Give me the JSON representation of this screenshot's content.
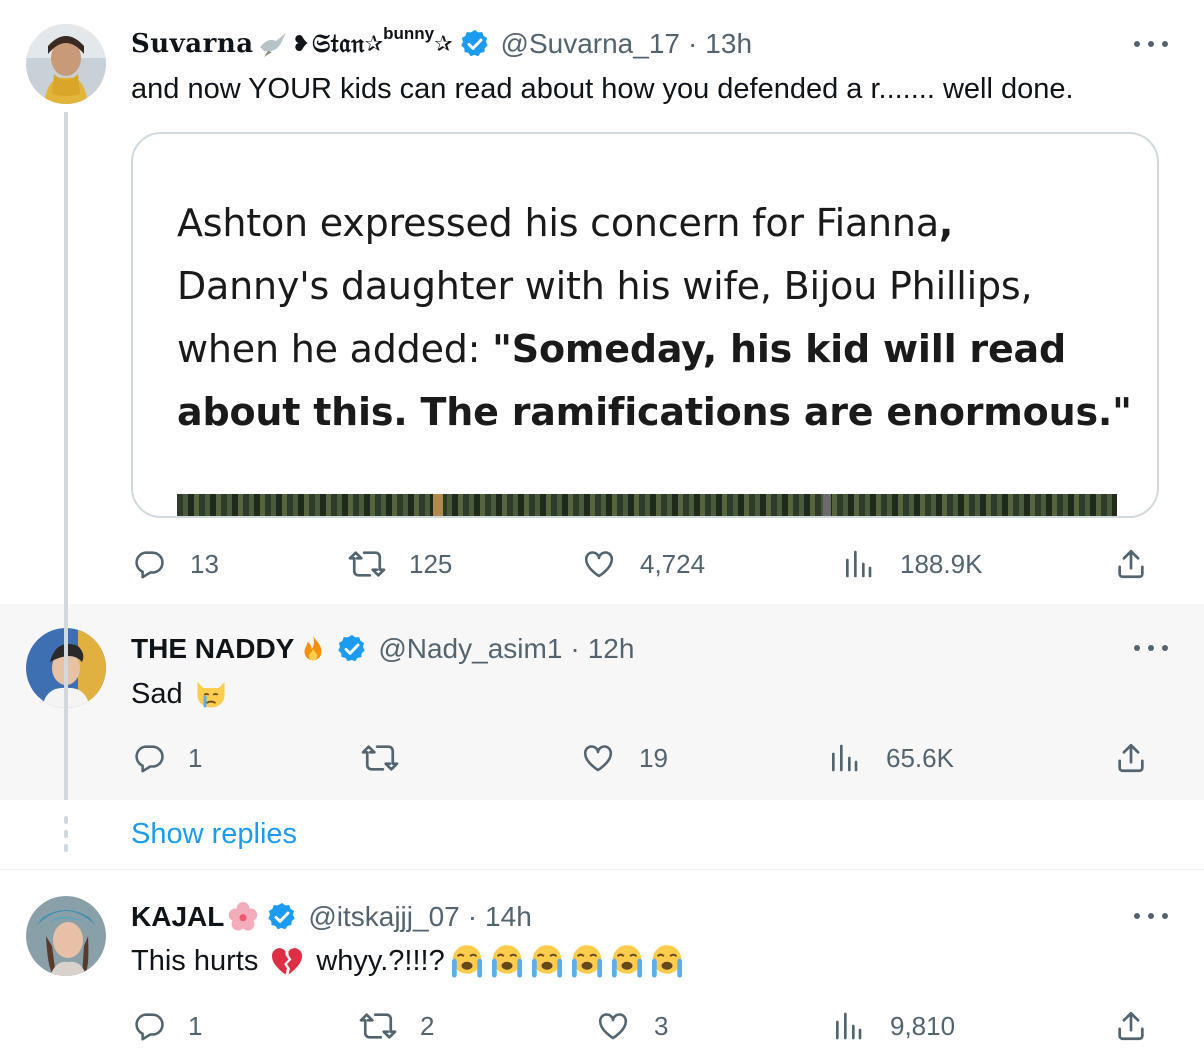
{
  "tweets": [
    {
      "name": "Suvarna",
      "name_decor": "𝔖𝔱𝔞𝔫",
      "name_sup": "bunny",
      "handle": "@Suvarna_17",
      "time": "13h",
      "text": "and now YOUR kids can read about how you defended a r....... well done.",
      "quote_card": {
        "line1_a": "Ashton expressed his concern for Fianna",
        "line1_b": ",",
        "line2": "Danny's daughter with his wife, Bijou Phillips,",
        "line3_a": "when he added: ",
        "line3_b": "\"Someday, his kid will read",
        "line4": "about this. The ramifications are enormous.\""
      },
      "stats": {
        "replies": "13",
        "reposts": "125",
        "likes": "4,724",
        "views": "188.9K"
      }
    },
    {
      "name": "THE NADDY",
      "handle": "@Nady_asim1",
      "time": "12h",
      "text": "Sad",
      "stats": {
        "replies": "1",
        "reposts": "",
        "likes": "19",
        "views": "65.6K"
      }
    },
    {
      "name": "KAJAL",
      "handle": "@itskajjj_07",
      "time": "14h",
      "text_a": "This hurts",
      "text_b": "whyy.?!!!?",
      "stats": {
        "replies": "1",
        "reposts": "2",
        "likes": "3",
        "views": "9,810"
      }
    }
  ],
  "show_replies": "Show replies",
  "icons": [
    "reply-icon",
    "repost-icon",
    "like-icon",
    "views-icon",
    "share-icon",
    "verified-badge-icon",
    "more-icon"
  ],
  "colors": {
    "verified": "#1d9bf0",
    "link": "#1d9bf0",
    "secondary_text": "#536471",
    "highlight_bg": "#f7f7f7"
  }
}
